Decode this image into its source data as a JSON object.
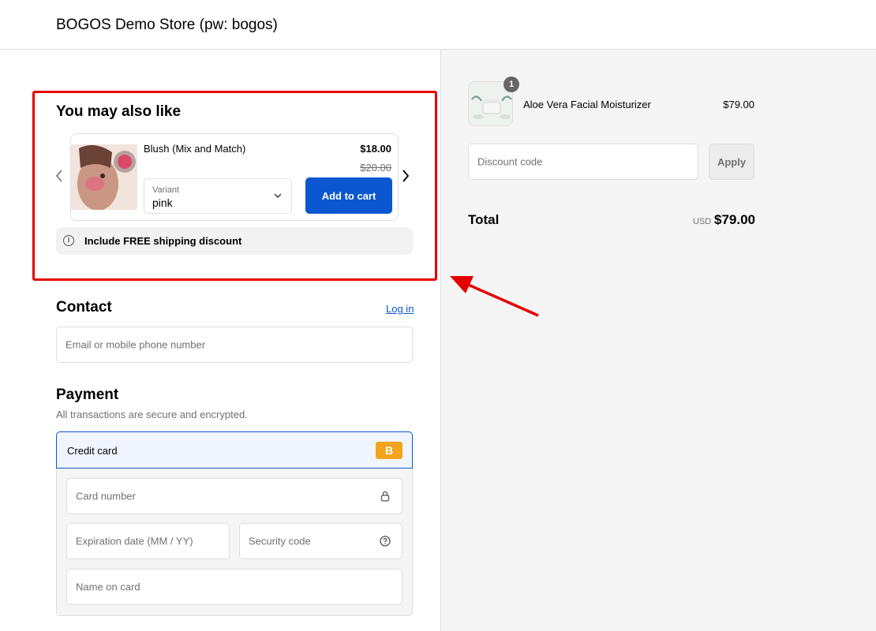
{
  "header": {
    "store_name": "BOGOS Demo Store (pw: bogos)"
  },
  "upsell": {
    "title": "You may also like",
    "product": {
      "name": "Blush (Mix and Match)",
      "price": "$18.00",
      "compare_price": "$20.00",
      "variant_label": "Variant",
      "variant_value": "pink",
      "add_label": "Add to cart"
    },
    "free_shipping_text": "Include FREE shipping discount"
  },
  "contact": {
    "title": "Contact",
    "login_label": "Log in",
    "email_placeholder": "Email or mobile phone number"
  },
  "payment": {
    "title": "Payment",
    "subtitle": "All transactions are secure and encrypted.",
    "method_label": "Credit card",
    "method_badge": "B",
    "card_number_placeholder": "Card number",
    "expiry_placeholder": "Expiration date (MM / YY)",
    "security_placeholder": "Security code",
    "name_placeholder": "Name on card"
  },
  "summary": {
    "item": {
      "quantity": "1",
      "name": "Aloe Vera Facial Moisturizer",
      "price": "$79.00"
    },
    "discount_placeholder": "Discount code",
    "apply_label": "Apply",
    "total_label": "Total",
    "total_currency": "USD",
    "total_value": "$79.00"
  },
  "colors": {
    "accent": "#0b57d0",
    "highlight": "#e50000",
    "badge": "#f2a41c"
  }
}
